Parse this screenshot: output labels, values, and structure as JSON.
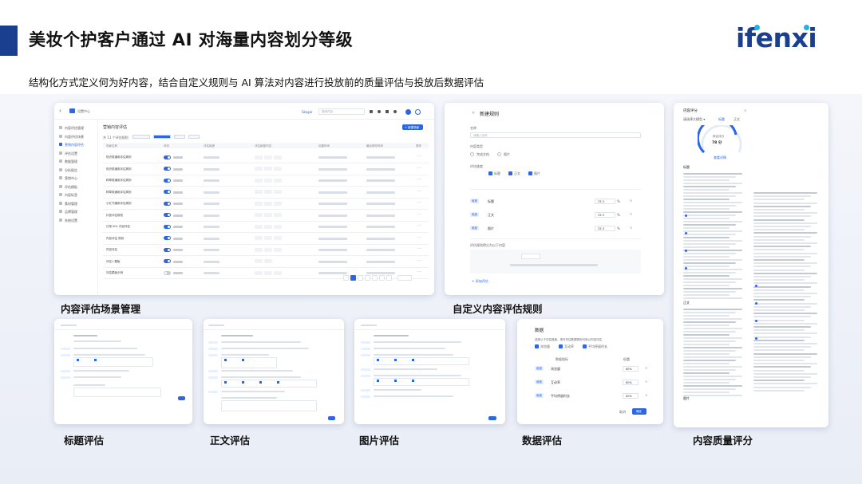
{
  "header": {
    "title": "美妆个护客户通过 AI 对海量内容划分等级",
    "logo_text": "ifenxi",
    "subtitle": "结构化方式定义何为好内容，结合自定义规则与 AI 算法对内容进行投放前的质量评估与投放后数据评估"
  },
  "captions": {
    "scene": "内容评估场景管理",
    "rules": "自定义内容评估规则",
    "title_eval": "标题评估",
    "body_eval": "正文评估",
    "image_eval": "图片评估",
    "data_eval": "数据评估",
    "quality": "内容质量评分"
  },
  "colors": {
    "brand": "#1a3f8f",
    "accent_blue": "#2b66e8",
    "logo_dot": "#1fb3e6"
  },
  "scene_card": {
    "breadcrumb": "设置中心",
    "user": "Skogie",
    "search_placeholder": "搜索内容",
    "section_title": "营销内容评估",
    "add_button": "+ 新建场景",
    "columns": [
      "场景名称",
      "状态",
      "评估维度",
      "评估维度内容",
      "创建时间",
      "最后修改时间",
      "操作"
    ],
    "rows": [
      {
        "name": "知识类通用评估规则",
        "on": true
      },
      {
        "name": "知识类通用评估规则",
        "on": true
      },
      {
        "name": "种草类通用评估规则",
        "on": true
      },
      {
        "name": "种草类通用评估规则",
        "on": true
      },
      {
        "name": "小红书通用评估规则",
        "on": true
      },
      {
        "name": "抖音评估规则",
        "on": true
      },
      {
        "name": "日常 KOL 内容评估",
        "on": true
      },
      {
        "name": "内容评估 规则",
        "on": true
      },
      {
        "name": "内容评估",
        "on": true
      },
      {
        "name": "评估1 模板",
        "on": true
      },
      {
        "name": "评估模板示例",
        "on": false
      }
    ],
    "sidebar": [
      "内容评估管理",
      "内容评估场景",
      "营销内容评估",
      "评估设置",
      "数据管理",
      "分析报告",
      "营销中心",
      "评估模板",
      "内容标签",
      "素材管理",
      "品牌管理",
      "系统设置"
    ]
  },
  "rules_card": {
    "title": "新建规则",
    "name_label": "名称",
    "name_placeholder": "请输入名称",
    "type_label": "内容类型",
    "type_options": [
      "完成文档",
      "图片"
    ],
    "dims_label": "评估维度",
    "dims": [
      "标题",
      "正文",
      "图片"
    ],
    "rows": [
      {
        "tag": "维度",
        "name": "标题",
        "value": "33.3",
        "unit": "%"
      },
      {
        "tag": "维度",
        "name": "正文",
        "value": "33.3",
        "unit": "%"
      },
      {
        "tag": "维度",
        "name": "图片",
        "value": "33.3",
        "unit": "%"
      }
    ],
    "score_label": "评估规则得分为以下内容",
    "add_rule": "+ 添加评估"
  },
  "data_card": {
    "title": "数据",
    "hint": "选择以下评估维度，填写评估数据规则可用以内容评估",
    "checks": [
      "浏览量",
      "互动率",
      "平均停留时长"
    ],
    "col_dim": "数据指标",
    "col_weight": "权重",
    "rows": [
      {
        "tag": "维度",
        "name": "浏览量",
        "value": "60%"
      },
      {
        "tag": "维度",
        "name": "互动率",
        "value": "60%"
      },
      {
        "tag": "维度",
        "name": "平均停留时长",
        "value": "60%"
      }
    ],
    "cancel": "取消",
    "confirm": "确定"
  },
  "quality_card": {
    "title": "内容评分",
    "score_label": "综合评分",
    "score": "78",
    "score_unit": "分",
    "tabs": [
      "标题",
      "正文",
      "图片"
    ],
    "link": "查看详情",
    "sections": [
      "标题",
      "正文",
      "图片"
    ]
  }
}
